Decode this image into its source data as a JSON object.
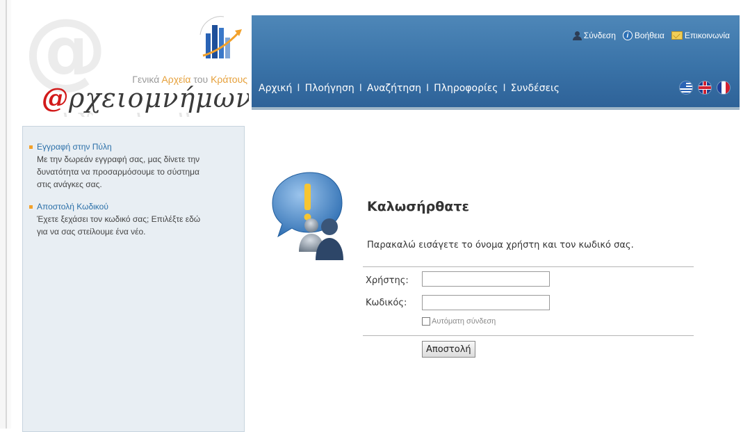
{
  "logo": {
    "subtitle_part1": "Γενικά ",
    "subtitle_part2": "Αρχεία",
    "subtitle_part3": " του ",
    "subtitle_part4": "Κράτους",
    "brand_at": "@",
    "brand_text": "ρχειομνήμων"
  },
  "top_links": [
    {
      "label": "Σύνδεση",
      "icon": "user-icon"
    },
    {
      "label": "Βοήθεια",
      "icon": "help-icon"
    },
    {
      "label": "Επικοινωνία",
      "icon": "mail-icon"
    }
  ],
  "nav": {
    "items": [
      "Αρχική",
      "Πλοήγηση",
      "Αναζήτηση",
      "Πληροφορίες",
      "Συνδέσεις"
    ],
    "separator": "I"
  },
  "flags": [
    "greek-flag-icon",
    "uk-flag-icon",
    "french-flag-icon"
  ],
  "sidebar": {
    "items": [
      {
        "link": "Εγγραφή στην Πύλη",
        "description": "Με την δωρεάν εγγραφή σας, μας δίνετε την δυνατότητα να προσαρμόσουμε το σύστημα στις ανάγκες σας."
      },
      {
        "link": "Αποστολή Κωδικού",
        "description": "Έχετε ξεχάσει τον κωδικό σας; Επιλέξτε εδώ για να σας στείλουμε ένα νέο."
      }
    ]
  },
  "login": {
    "title": "Καλωσήρθατε",
    "intro": "Παρακαλώ εισάγετε το όνομα χρήστη και τον κωδικό σας.",
    "username_label": "Χρήστης:",
    "username_value": "",
    "password_label": "Κωδικός:",
    "password_value": "",
    "remember_label": "Αυτόματη σύνδεση",
    "submit_label": "Αποστολή"
  },
  "colors": {
    "header_blue": "#3a73a8",
    "sidebar_bg": "#e8eef3",
    "link_blue": "#2a6fa8",
    "bullet_orange": "#f2a12b",
    "brand_red": "#d21a1a"
  }
}
